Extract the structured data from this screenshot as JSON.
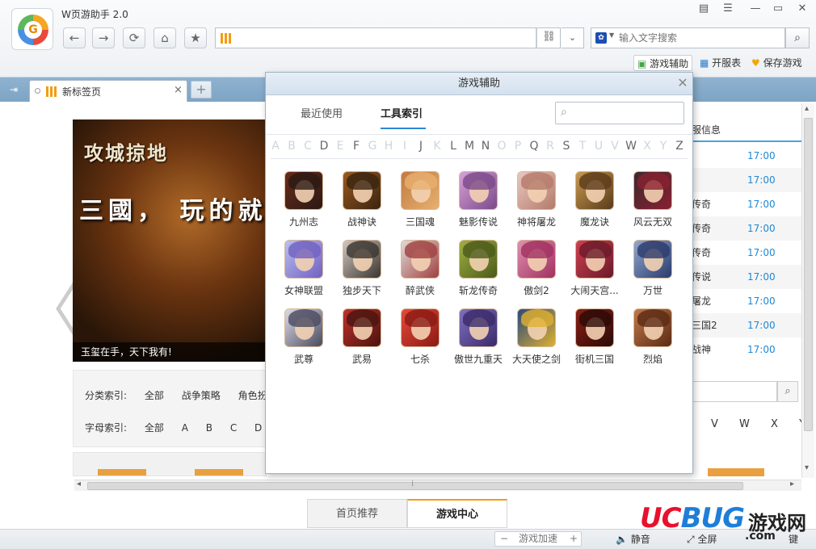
{
  "app": {
    "title": "W页游助手 2.0",
    "logo_glyph": "G"
  },
  "toolbar": {
    "back": "←",
    "forward": "→",
    "refresh": "⟳",
    "home": "⌂",
    "favorite": "★",
    "address_value": "",
    "link_icon": "⛓",
    "dropdown": "⌄",
    "search_placeholder": "输入文字搜索",
    "search_engine_glyph": "✿",
    "search_btn": "⌕"
  },
  "window_controls": {
    "menu": "▤",
    "options": "☰",
    "minimize": "—",
    "maximize": "▭",
    "close": "✕"
  },
  "right_tools": [
    {
      "icon": "▣",
      "label": "游戏辅助",
      "color": "#4aa34a"
    },
    {
      "icon": "▦",
      "label": "开服表",
      "color": "#2a7bc8"
    },
    {
      "icon": "♥",
      "label": "保存游戏",
      "color": "#f0a800"
    }
  ],
  "tabs": {
    "side_icon": "⇥",
    "items": [
      {
        "label": "新标签页",
        "close": "×"
      }
    ],
    "new_tab": "+"
  },
  "banner": {
    "logo_text": "攻城掠地",
    "slogan": "三國， 玩的就",
    "caption": "玉玺在手，天下我有!"
  },
  "page": {
    "prev_arrow": "〈"
  },
  "filters": {
    "category_label": "分类索引:",
    "categories": [
      "全部",
      "战争策略",
      "角色扮"
    ],
    "letter_label": "字母索引:",
    "letters": [
      "全部",
      "A",
      "B",
      "C",
      "D"
    ]
  },
  "server_list": {
    "header": "服信息",
    "rows": [
      {
        "name": "",
        "time": "17:00"
      },
      {
        "name": "",
        "time": "17:00"
      },
      {
        "name": "传奇",
        "time": "17:00"
      },
      {
        "name": "传奇",
        "time": "17:00"
      },
      {
        "name": "传奇",
        "time": "17:00"
      },
      {
        "name": "传说",
        "time": "17:00"
      },
      {
        "name": "屠龙",
        "time": "17:00"
      },
      {
        "name": "三国2",
        "time": "17:00"
      },
      {
        "name": "战神",
        "time": "17:00"
      }
    ],
    "search_btn": "⌕",
    "letters": [
      "V",
      "W",
      "X",
      "Y"
    ]
  },
  "scrollbar": {
    "h_grip": "⁞",
    "left": "◂",
    "right": "▸",
    "up": "▴",
    "down": "▾"
  },
  "bottom_tabs": [
    "首页推荐",
    "游戏中心"
  ],
  "statusbar": {
    "accel_minus": "−",
    "accel_label": "游戏加速",
    "accel_plus": "+",
    "mute_icon": "🔈",
    "mute": "静音",
    "fullscreen_icon": "⤢",
    "fullscreen": "全屏",
    "shortcut": "键"
  },
  "watermark": {
    "brand_a": "UC",
    "brand_b": "BUG",
    "text": "游戏网",
    "domain": ".com"
  },
  "modal": {
    "title": "游戏辅助",
    "close": "✕",
    "tabs": [
      "最近使用",
      "工具索引"
    ],
    "active_tab": 1,
    "search_icon": "⌕",
    "alphabet": [
      "A",
      "B",
      "C",
      "D",
      "E",
      "F",
      "G",
      "H",
      "I",
      "J",
      "K",
      "L",
      "M",
      "N",
      "O",
      "P",
      "Q",
      "R",
      "S",
      "T",
      "U",
      "V",
      "W",
      "X",
      "Y",
      "Z"
    ],
    "alphabet_enabled": [
      "D",
      "F",
      "J",
      "L",
      "M",
      "N",
      "Q",
      "S",
      "W",
      "Z"
    ],
    "games": [
      {
        "name": "九州志",
        "c1": "#6a2a1a",
        "c2": "#2a1a14"
      },
      {
        "name": "战神诀",
        "c1": "#9a5a20",
        "c2": "#3a2410"
      },
      {
        "name": "三国魂",
        "c1": "#c07a40",
        "c2": "#e8b070"
      },
      {
        "name": "魅影传说",
        "c1": "#d9a0d8",
        "c2": "#7a4a8a"
      },
      {
        "name": "神将屠龙",
        "c1": "#e8c8c0",
        "c2": "#b47a6a"
      },
      {
        "name": "魔龙诀",
        "c1": "#c89a50",
        "c2": "#5a3a1a"
      },
      {
        "name": "风云无双",
        "c1": "#3a2a30",
        "c2": "#8a2030"
      },
      {
        "name": "女神联盟",
        "c1": "#b8c0f0",
        "c2": "#7060c0"
      },
      {
        "name": "独步天下",
        "c1": "#d0c8c0",
        "c2": "#3a3430"
      },
      {
        "name": "醉武侠",
        "c1": "#e0dcd8",
        "c2": "#a04040"
      },
      {
        "name": "斩龙传奇",
        "c1": "#a0b040",
        "c2": "#4a5a1a"
      },
      {
        "name": "傲剑2",
        "c1": "#e090b0",
        "c2": "#a03060"
      },
      {
        "name": "大闹天宫...",
        "c1": "#d04050",
        "c2": "#6a1a2a"
      },
      {
        "name": "万世",
        "c1": "#90a8d0",
        "c2": "#2a3a6a"
      },
      {
        "name": "武尊",
        "c1": "#dcdce8",
        "c2": "#4a4a60"
      },
      {
        "name": "武易",
        "c1": "#c0302a",
        "c2": "#4a1410"
      },
      {
        "name": "七杀",
        "c1": "#e84a3a",
        "c2": "#8a1a14"
      },
      {
        "name": "傲世九重天",
        "c1": "#8070c0",
        "c2": "#3a2a6a"
      },
      {
        "name": "大天使之剑",
        "c1": "#2a4a7a",
        "c2": "#e0b030"
      },
      {
        "name": "街机三国",
        "c1": "#8a2014",
        "c2": "#2a0a08"
      },
      {
        "name": "烈焰",
        "c1": "#c07a4a",
        "c2": "#5a2a14"
      }
    ]
  }
}
